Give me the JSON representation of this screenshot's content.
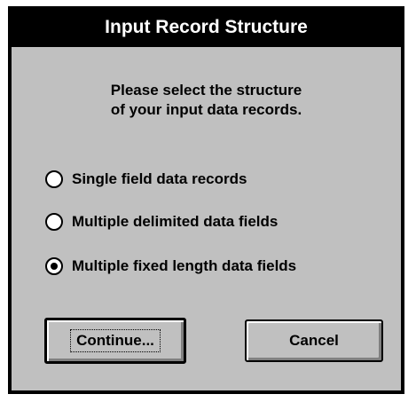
{
  "dialog": {
    "title": "Input Record Structure",
    "prompt_line1": "Please select the structure",
    "prompt_line2": "of your input data records."
  },
  "options": [
    {
      "label": "Single field data records",
      "selected": false
    },
    {
      "label": "Multiple delimited data fields",
      "selected": false
    },
    {
      "label": "Multiple fixed length data fields",
      "selected": true
    }
  ],
  "buttons": {
    "continue_label": "Continue...",
    "cancel_label": "Cancel"
  }
}
